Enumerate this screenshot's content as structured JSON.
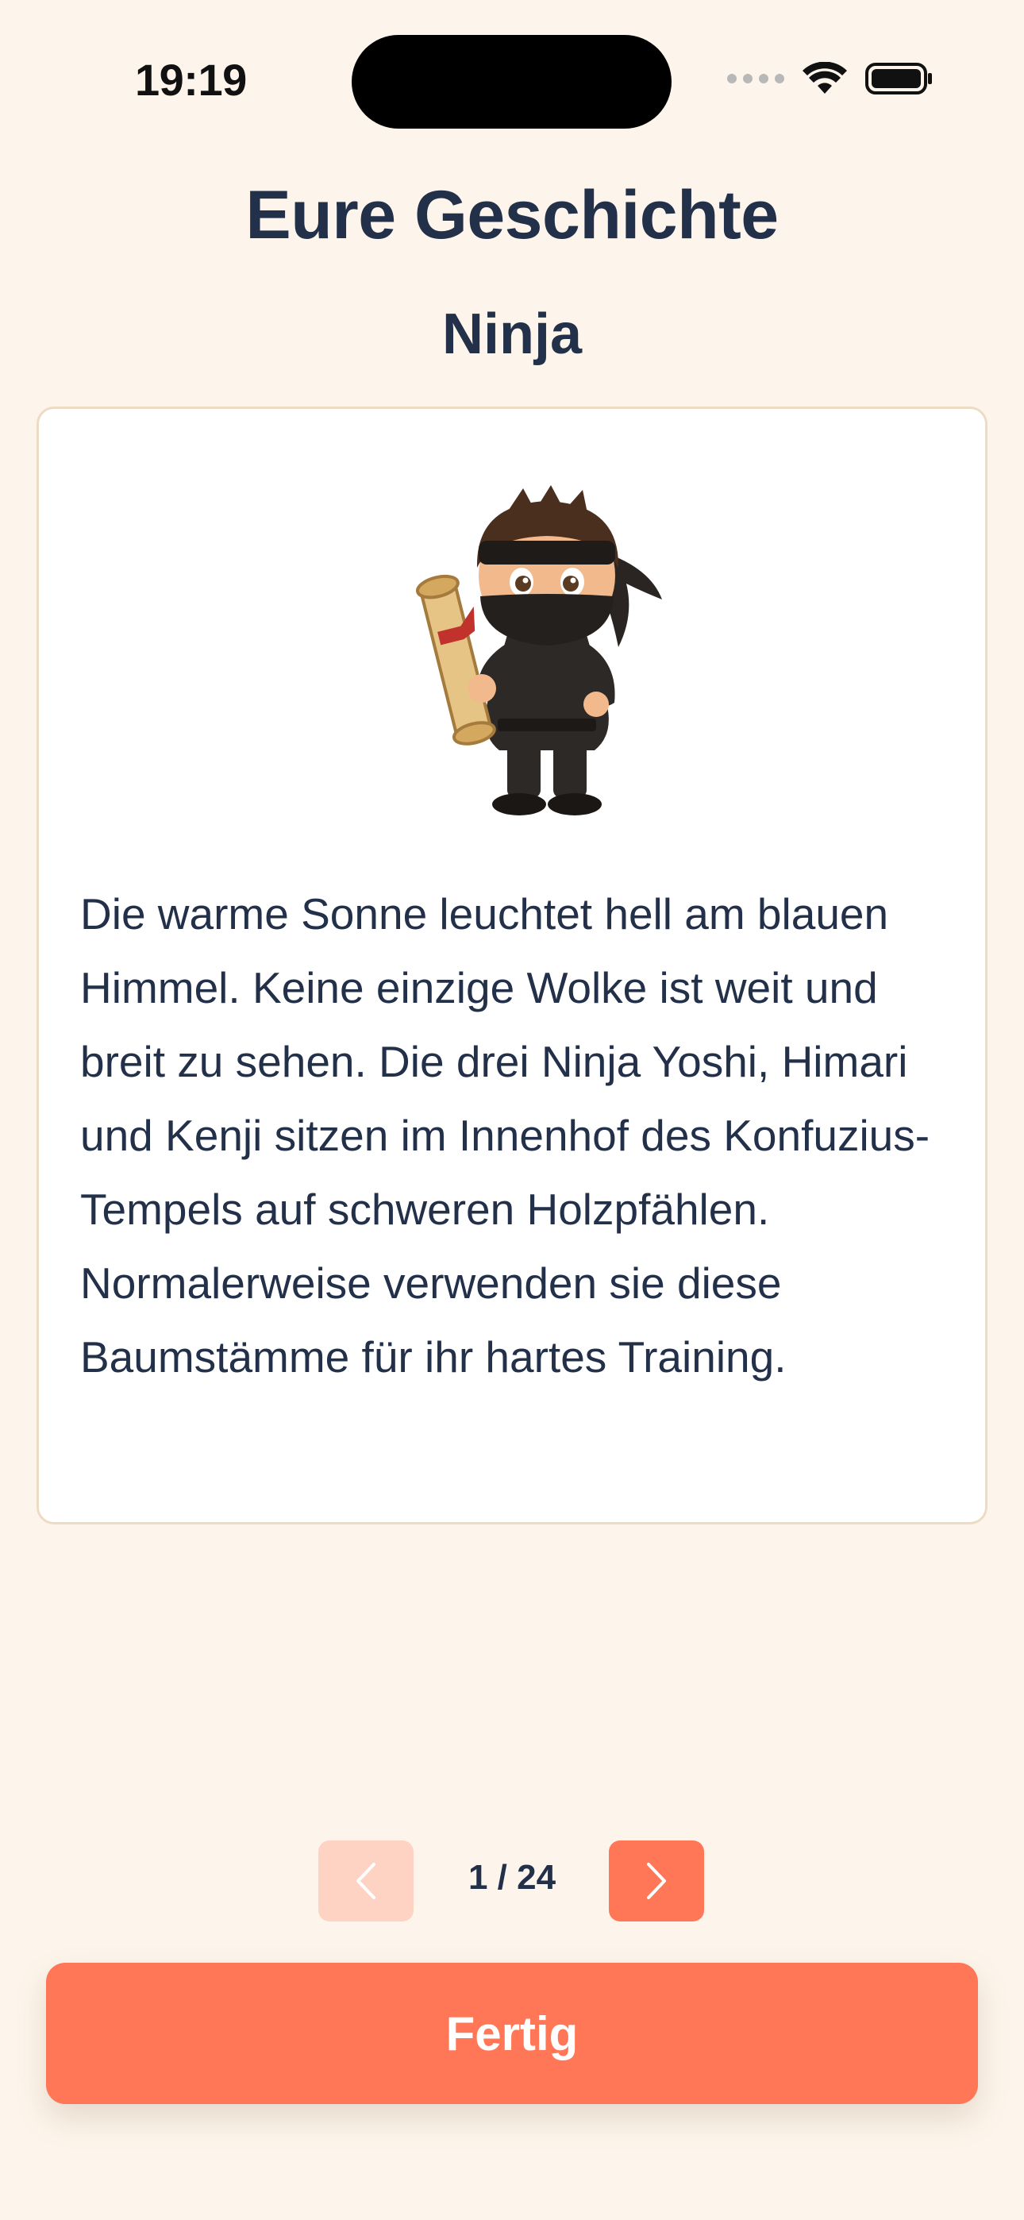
{
  "status_bar": {
    "time": "19:19"
  },
  "header": {
    "title": "Eure Geschichte",
    "story_name": "Ninja"
  },
  "story_card": {
    "illustration": "ninja-character-with-scroll",
    "text": "Die warme Sonne leuchtet hell am blauen Himmel. Keine einzige Wolke ist weit und breit zu sehen. Die drei Ninja Yoshi, Himari und Kenji sitzen im Innenhof des Konfuzius-Tempels auf schweren Holzpfählen. Normalerweise verwenden sie diese Baumstämme für ihr hartes Training."
  },
  "pagination": {
    "indicator": "1 / 24",
    "current_page": 1,
    "total_pages": 24,
    "prev_icon": "chevron-left-icon",
    "next_icon": "chevron-right-icon"
  },
  "actions": {
    "done_label": "Fertig"
  },
  "colors": {
    "background": "#fdf5eb",
    "accent": "#ff7756",
    "accent_disabled": "#ffd3c4",
    "text": "#22304a"
  }
}
